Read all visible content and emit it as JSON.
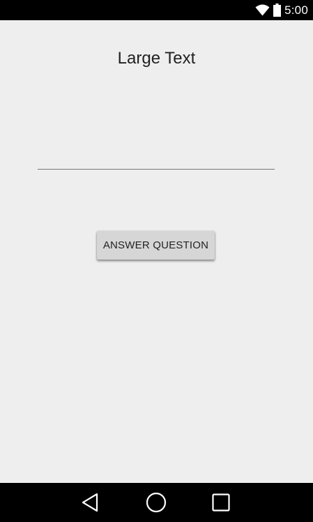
{
  "status_bar": {
    "time": "5:00",
    "icons": [
      "wifi-icon",
      "battery-icon"
    ]
  },
  "main": {
    "title": "Large Text",
    "answer_input": {
      "value": "",
      "placeholder": ""
    },
    "answer_button_label": "ANSWER QUESTION"
  },
  "nav_bar": {
    "buttons": [
      "back-icon",
      "home-icon",
      "recents-icon"
    ]
  },
  "colors": {
    "background": "#eeeeee",
    "system_bars": "#000000",
    "button": "#d6d6d6",
    "text": "#222222",
    "input_underline": "#757575"
  }
}
